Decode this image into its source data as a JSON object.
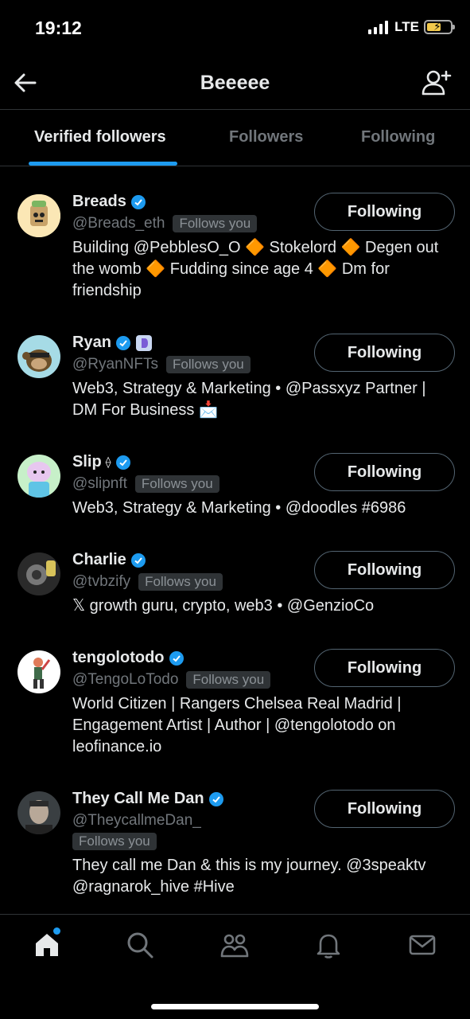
{
  "status": {
    "time": "19:12",
    "network": "LTE"
  },
  "header": {
    "title": "Beeeee"
  },
  "tabs": [
    {
      "label": "Verified followers",
      "active": true
    },
    {
      "label": "Followers",
      "active": false
    },
    {
      "label": "Following",
      "active": false
    }
  ],
  "users": [
    {
      "name": "Breads",
      "handle": "@Breads_eth",
      "follows_you": "Follows you",
      "button": "Following",
      "bio": "Building @PebblesO_O 🔶 Stokelord 🔶 Degen out the womb 🔶 Fudding since age 4 🔶 Dm for friendship"
    },
    {
      "name": "Ryan",
      "handle": "@RyanNFTs",
      "follows_you": "Follows you",
      "button": "Following",
      "bio": "Web3, Strategy & Marketing • @Passxyz Partner | DM For Business 📩"
    },
    {
      "name": "Slip",
      "name_suffix": "⟠",
      "handle": "@slipnft",
      "follows_you": "Follows you",
      "button": "Following",
      "bio": "Web3, Strategy & Marketing • @doodles #6986"
    },
    {
      "name": "Charlie",
      "handle": "@tvbzify",
      "follows_you": "Follows you",
      "button": "Following",
      "bio": "𝕏 growth guru, crypto, web3 • @GenzioCo"
    },
    {
      "name": "tengolotodo",
      "handle": "@TengoLoTodo",
      "follows_you": "Follows you",
      "button": "Following",
      "bio": "World Citizen | Rangers Chelsea Real Madrid | Engagement Artist | Author | @tengolotodo on leofinance.io"
    },
    {
      "name": "They Call Me Dan",
      "handle": "@TheycallmeDan_",
      "follows_you": "Follows you",
      "button": "Following",
      "bio": "They call me Dan & this is my journey. @3speaktv @ragnarok_hive #Hive"
    }
  ],
  "nav": [
    "home-icon",
    "search-icon",
    "communities-icon",
    "notifications-icon",
    "messages-icon"
  ],
  "colors": {
    "accent": "#1d9bf0",
    "background": "#000000",
    "muted": "#71767b"
  }
}
